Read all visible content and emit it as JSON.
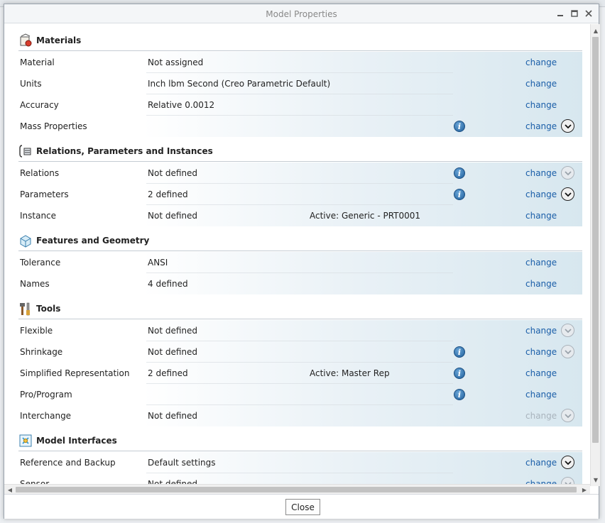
{
  "dialog": {
    "title": "Model Properties",
    "close_label": "Close"
  },
  "sections": [
    {
      "title": "Materials",
      "icon": "materials-icon",
      "rows": [
        {
          "label": "Material",
          "value": "Not assigned",
          "extra": "",
          "info": false,
          "change": "change",
          "change_enabled": true,
          "expand": "none"
        },
        {
          "label": "Units",
          "value": "Inch lbm Second (Creo Parametric Default)",
          "extra": "",
          "info": false,
          "change": "change",
          "change_enabled": true,
          "expand": "none"
        },
        {
          "label": "Accuracy",
          "value": "Relative 0.0012",
          "extra": "",
          "info": false,
          "change": "change",
          "change_enabled": true,
          "expand": "none"
        },
        {
          "label": "Mass Properties",
          "value": "",
          "extra": "",
          "info": true,
          "change": "change",
          "change_enabled": true,
          "expand": "dark"
        }
      ]
    },
    {
      "title": "Relations, Parameters and Instances",
      "icon": "relations-icon",
      "rows": [
        {
          "label": "Relations",
          "value": "Not defined",
          "extra": "",
          "info": true,
          "change": "change",
          "change_enabled": true,
          "expand": "light"
        },
        {
          "label": "Parameters",
          "value": "2 defined",
          "extra": "",
          "info": true,
          "change": "change",
          "change_enabled": true,
          "expand": "dark"
        },
        {
          "label": "Instance",
          "value": "Not defined",
          "extra": "Active: Generic - PRT0001",
          "info": false,
          "change": "change",
          "change_enabled": true,
          "expand": "none"
        }
      ]
    },
    {
      "title": "Features and Geometry",
      "icon": "features-icon",
      "rows": [
        {
          "label": "Tolerance",
          "value": "ANSI",
          "extra": "",
          "info": false,
          "change": "change",
          "change_enabled": true,
          "expand": "none"
        },
        {
          "label": "Names",
          "value": "4 defined",
          "extra": "",
          "info": false,
          "change": "change",
          "change_enabled": true,
          "expand": "none"
        }
      ]
    },
    {
      "title": "Tools",
      "icon": "tools-icon",
      "rows": [
        {
          "label": "Flexible",
          "value": "Not defined",
          "extra": "",
          "info": false,
          "change": "change",
          "change_enabled": true,
          "expand": "light"
        },
        {
          "label": "Shrinkage",
          "value": "Not defined",
          "extra": "",
          "info": true,
          "change": "change",
          "change_enabled": true,
          "expand": "light"
        },
        {
          "label": "Simplified Representation",
          "value": "2 defined",
          "extra": "Active: Master Rep",
          "info": true,
          "change": "change",
          "change_enabled": true,
          "expand": "none"
        },
        {
          "label": "Pro/Program",
          "value": "",
          "extra": "",
          "info": true,
          "change": "change",
          "change_enabled": true,
          "expand": "none"
        },
        {
          "label": "Interchange",
          "value": "Not defined",
          "extra": "",
          "info": false,
          "change": "change",
          "change_enabled": false,
          "expand": "light"
        }
      ]
    },
    {
      "title": "Model Interfaces",
      "icon": "model-interfaces-icon",
      "rows": [
        {
          "label": "Reference and Backup",
          "value": "Default settings",
          "extra": "",
          "info": false,
          "change": "change",
          "change_enabled": true,
          "expand": "dark"
        },
        {
          "label": "Sensor",
          "value": "Not defined",
          "extra": "",
          "info": false,
          "change": "change",
          "change_enabled": true,
          "expand": "light"
        }
      ]
    }
  ]
}
